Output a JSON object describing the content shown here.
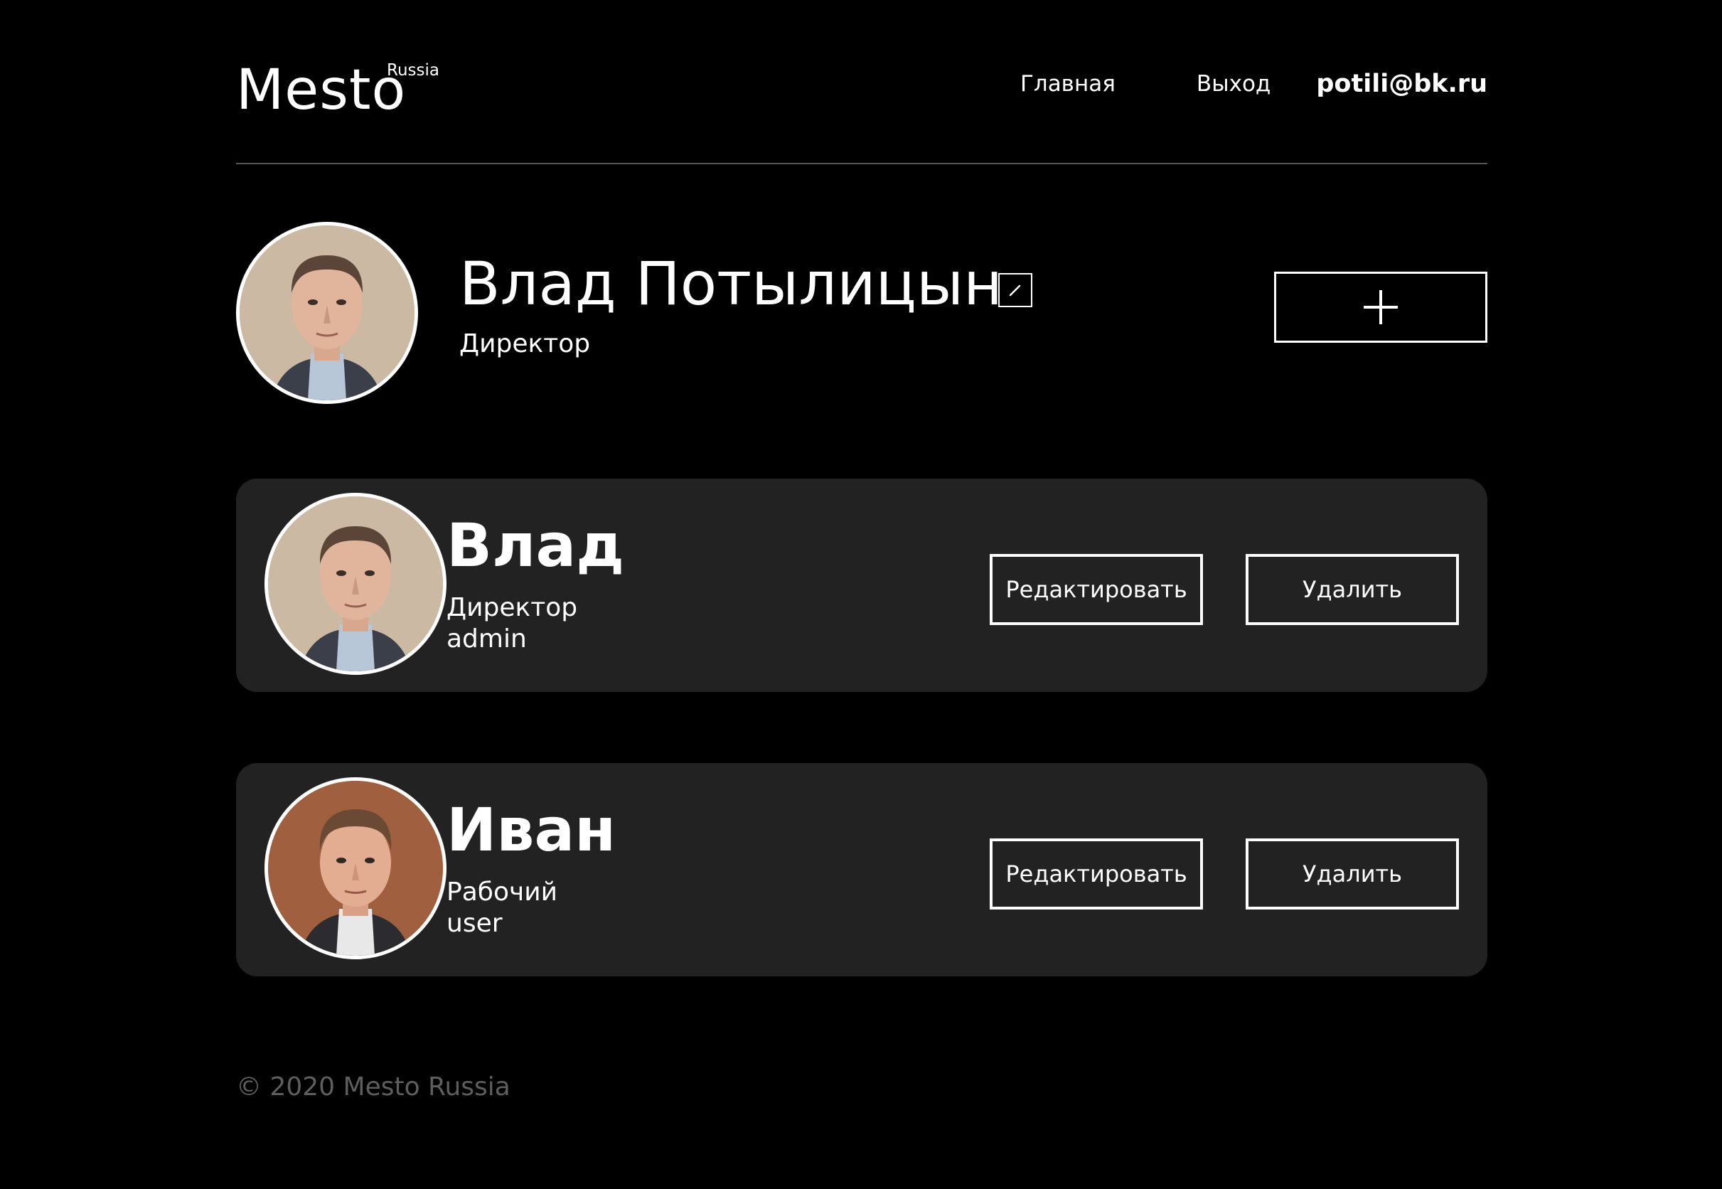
{
  "header": {
    "logo": "Mesto",
    "logo_sup": "Russia",
    "nav": {
      "home": "Главная",
      "logout": "Выход",
      "email": "potili@bk.ru"
    }
  },
  "profile": {
    "name": "Влад Потылицын",
    "job": "Директор",
    "edit_icon": "pencil-icon",
    "add_icon": "plus-icon"
  },
  "users": [
    {
      "name": "Влад",
      "job": "Директор",
      "role": "admin",
      "edit_label": "Редактировать",
      "delete_label": "Удалить"
    },
    {
      "name": "Иван",
      "job": "Рабочий",
      "role": "user",
      "edit_label": "Редактировать",
      "delete_label": "Удалить"
    }
  ],
  "footer": {
    "copyright": "© 2020 Mesto Russia"
  },
  "colors": {
    "background": "#000000",
    "card": "#222222",
    "footer_text": "#5e5e5e",
    "divider": "#545454"
  }
}
